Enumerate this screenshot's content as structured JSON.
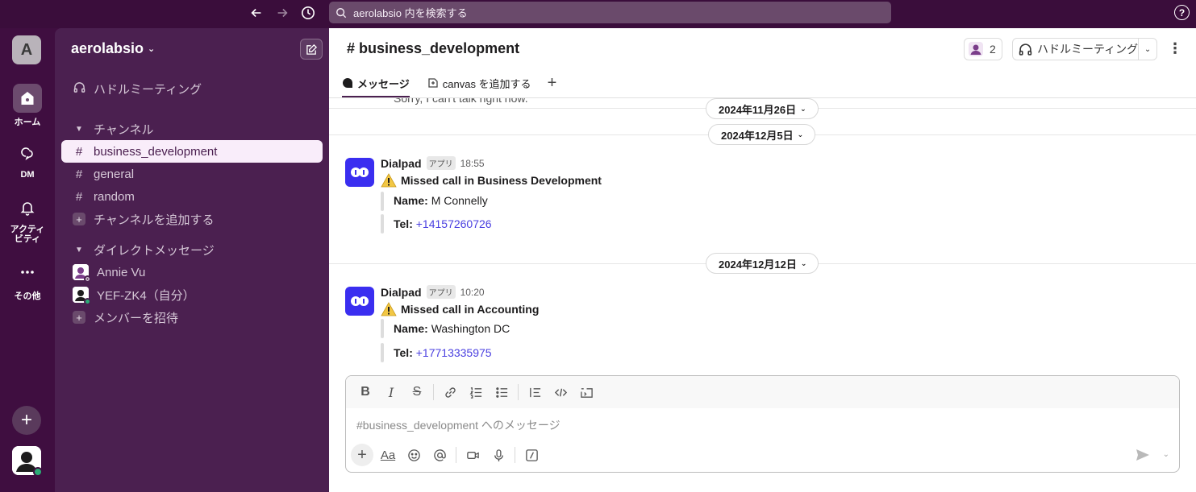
{
  "topbar": {
    "search_text": "aerolabsio 内を検索する",
    "help_label": "?"
  },
  "rail": {
    "workspace_initial": "A",
    "home_label": "ホーム",
    "dm_label": "DM",
    "activity_label": "アクティビティ",
    "more_label": "その他",
    "add_label": "+"
  },
  "sidebar": {
    "workspace_name": "aerolabsio",
    "huddle_label": "ハドルミーティング",
    "channels_header": "チャンネル",
    "channels": [
      {
        "name": "business_development",
        "active": true
      },
      {
        "name": "general",
        "active": false
      },
      {
        "name": "random",
        "active": false
      }
    ],
    "add_channel_label": "チャンネルを追加する",
    "dm_header": "ダイレクトメッセージ",
    "dms": [
      {
        "name": "Annie Vu",
        "status": "away"
      },
      {
        "name": "YEF-ZK4（自分）",
        "status": "online"
      }
    ],
    "invite_label": "メンバーを招待"
  },
  "channel": {
    "title": "# business_development",
    "member_count": "2",
    "huddle_button": "ハドルミーティング",
    "tabs": [
      {
        "label": "メッセージ"
      },
      {
        "label": "canvas を追加する"
      }
    ],
    "tab_add": "+"
  },
  "messages": {
    "cut_text": "Sorry, I can't talk right now.",
    "dates": [
      "2024年11月26日",
      "2024年12月5日",
      "2024年12月12日"
    ],
    "items": [
      {
        "sender": "Dialpad",
        "badge": "アプリ",
        "time": "18:55",
        "subject": "Missed call in Business Development",
        "name_label": "Name:",
        "name_value": "M Connelly",
        "tel_label": "Tel:",
        "tel_value": "+14157260726"
      },
      {
        "sender": "Dialpad",
        "badge": "アプリ",
        "time": "10:20",
        "subject": "Missed call in Accounting",
        "name_label": "Name:",
        "name_value": "Washington DC",
        "tel_label": "Tel:",
        "tel_value": "+17713335975"
      }
    ]
  },
  "composer": {
    "placeholder": "#business_development へのメッセージ",
    "font_label": "Aa"
  },
  "colors": {
    "aubergine": "#3f0e40",
    "sidebar": "#4b2050",
    "link": "#4a3fe0",
    "dialpad": "#3a2ef0",
    "online": "#2bac76"
  }
}
